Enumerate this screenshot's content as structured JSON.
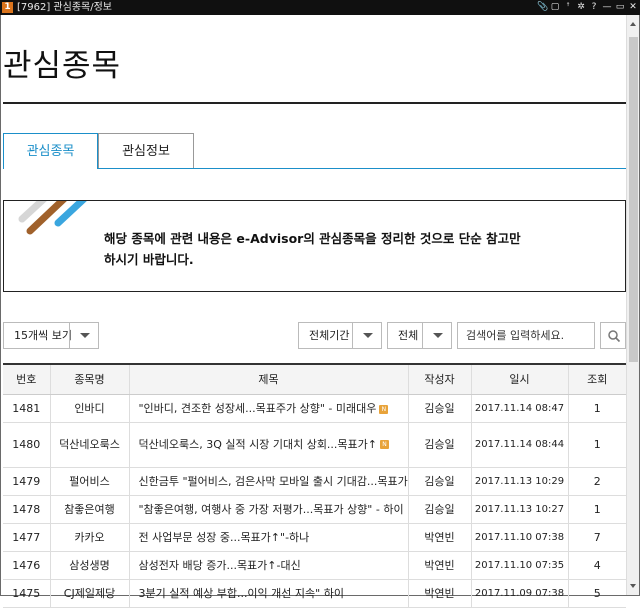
{
  "window": {
    "app_icon_text": "1",
    "title": "[7962] 관심종목/정보",
    "controls": [
      "📎",
      "▢",
      "ꜛ",
      "✲",
      "?",
      "—",
      "▭",
      "✕"
    ]
  },
  "page": {
    "title": "관심종목"
  },
  "tabs": [
    {
      "label": "관심종목",
      "active": true
    },
    {
      "label": "관심정보",
      "active": false
    }
  ],
  "notice": {
    "text": "해당 종목에 관련 내용은 e-Advisor의 관심종목을 정리한 것으로 단순 참고만 하시기 바랍니다."
  },
  "toolbar": {
    "page_size_label": "15개씩 보기",
    "period_label": "전체기간",
    "scope_label": "전체",
    "search_placeholder": "검색어를 입력하세요."
  },
  "table": {
    "headers": [
      "번호",
      "종목명",
      "제목",
      "작성자",
      "일시",
      "조회"
    ],
    "rows": [
      {
        "no": "1481",
        "stock": "인바디",
        "subject": "\"인바디, 견조한 성장세...목표주가 상향\" - 미래대우",
        "new": true,
        "author": "김승일",
        "date": "2017.11.14 08:47",
        "views": "1"
      },
      {
        "no": "1480",
        "stock": "덕산네오룩스",
        "subject": "덕산네오룩스, 3Q 실적 시장 기대치 상회...목표가↑",
        "new": true,
        "author": "김승일",
        "date": "2017.11.14 08:44",
        "views": "1"
      },
      {
        "no": "1479",
        "stock": "펄어비스",
        "subject": "신한금투 \"펄어비스, 검은사막 모바일 출시 기대감...목표가↑\"",
        "new": false,
        "author": "김승일",
        "date": "2017.11.13 10:29",
        "views": "2"
      },
      {
        "no": "1478",
        "stock": "참좋은여행",
        "subject": "\"참좋은여행, 여행사 중 가장 저평가...목표가 상향\" - 하이",
        "new": false,
        "author": "김승일",
        "date": "2017.11.13 10:27",
        "views": "1"
      },
      {
        "no": "1477",
        "stock": "카카오",
        "subject": "전 사업부문 성장 중...목표가↑\"-하나",
        "new": false,
        "author": "박연빈",
        "date": "2017.11.10 07:38",
        "views": "7"
      },
      {
        "no": "1476",
        "stock": "삼성생명",
        "subject": "삼성전자 배당 증가...목표가↑-대신",
        "new": false,
        "author": "박연빈",
        "date": "2017.11.10 07:35",
        "views": "4"
      },
      {
        "no": "1475",
        "stock": "CJ제일제당",
        "subject": "3분기 실적 예상 부합...이익 개선 지속\" 하이",
        "new": false,
        "author": "박연빈",
        "date": "2017.11.09 07:38",
        "views": "5"
      }
    ]
  }
}
